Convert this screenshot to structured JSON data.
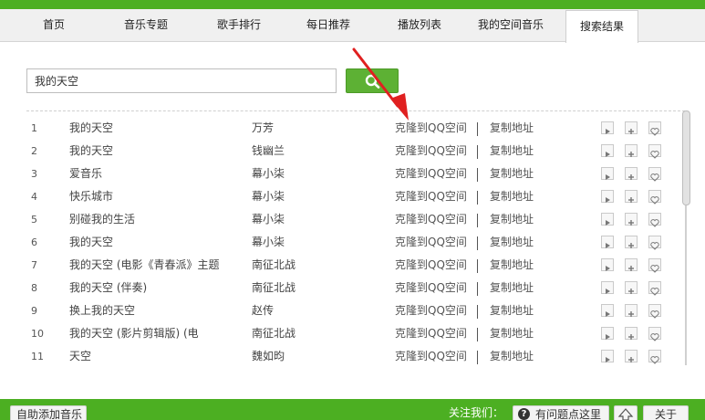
{
  "tabs": [
    {
      "label": "首页"
    },
    {
      "label": "音乐专题"
    },
    {
      "label": "歌手排行"
    },
    {
      "label": "每日推荐"
    },
    {
      "label": "播放列表"
    },
    {
      "label": "我的空间音乐"
    },
    {
      "label": "搜索结果"
    }
  ],
  "active_tab": "搜索结果",
  "search": {
    "value": "我的天空"
  },
  "row_actions": {
    "clone": "克隆到QQ空间",
    "copy": "复制地址"
  },
  "results": [
    {
      "num": "1",
      "title": "我的天空",
      "artist": "万芳"
    },
    {
      "num": "2",
      "title": "我的天空",
      "artist": "钱幽兰"
    },
    {
      "num": "3",
      "title": "爱音乐",
      "artist": "幕小柒"
    },
    {
      "num": "4",
      "title": "快乐城市",
      "artist": "幕小柒"
    },
    {
      "num": "5",
      "title": "别碰我的生活",
      "artist": "幕小柒"
    },
    {
      "num": "6",
      "title": "我的天空",
      "artist": "幕小柒"
    },
    {
      "num": "7",
      "title": "我的天空 (电影《青春派》主题",
      "artist": "南征北战"
    },
    {
      "num": "8",
      "title": "我的天空 (伴奏)",
      "artist": "南征北战"
    },
    {
      "num": "9",
      "title": "换上我的天空",
      "artist": "赵传"
    },
    {
      "num": "10",
      "title": "我的天空 (影片剪辑版) (电",
      "artist": "南征北战"
    },
    {
      "num": "11",
      "title": "天空",
      "artist": "魏如昀"
    }
  ],
  "footer": {
    "add_music": "自助添加音乐",
    "follow_label": "关注我们：",
    "help": "有问题点这里",
    "about": "关于"
  },
  "colors": {
    "brand_green": "#4caf22",
    "arrow_red": "#e02020"
  }
}
